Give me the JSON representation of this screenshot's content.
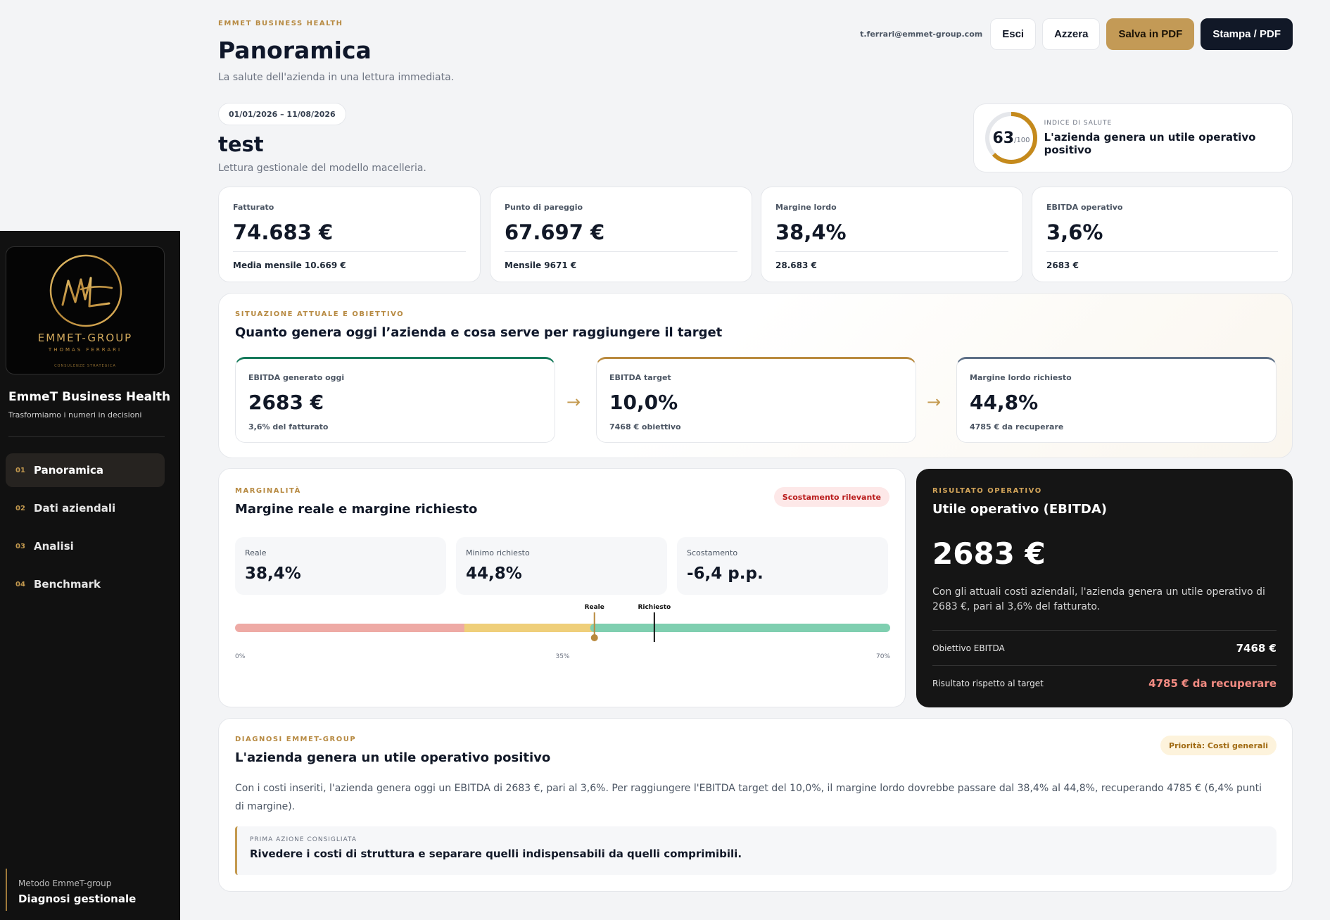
{
  "sidebar": {
    "logo": {
      "name": "EMMET-GROUP",
      "tagline": "THOMAS FERRARI",
      "micro": "CONSULENZE STRATEGICA"
    },
    "brand_title": "EmmeT Business Health",
    "brand_subtitle": "Trasformiamo i numeri in decisioni",
    "nav": [
      {
        "num": "01",
        "label": "Panoramica",
        "active": true
      },
      {
        "num": "02",
        "label": "Dati aziendali",
        "active": false
      },
      {
        "num": "03",
        "label": "Analisi",
        "active": false
      },
      {
        "num": "04",
        "label": "Benchmark",
        "active": false
      }
    ],
    "footer": {
      "line1": "Metodo EmmeT-group",
      "line2": "Diagnosi gestionale"
    }
  },
  "header": {
    "eyebrow": "EMMET BUSINESS HEALTH",
    "title": "Panoramica",
    "subtitle": "La salute dell'azienda in una lettura immediata.",
    "email": "t.ferrari@emmet-group.com",
    "buttons": {
      "logout": "Esci",
      "reset": "Azzera",
      "save_pdf": "Salva in PDF",
      "print": "Stampa / PDF"
    }
  },
  "company": {
    "period": "01/01/2026 – 11/08/2026",
    "name": "test",
    "subtitle": "Lettura gestionale del modello macelleria."
  },
  "health": {
    "score": 63,
    "score_suffix": "/100",
    "label": "INDICE DI SALUTE",
    "message": "L'azienda genera un utile operativo positivo",
    "color": "#c58a1c"
  },
  "kpis": [
    {
      "label": "Fatturato",
      "value": "74.683 €",
      "foot": "Media mensile 10.669 €"
    },
    {
      "label": "Punto di pareggio",
      "value": "67.697 €",
      "foot": "Mensile 9671 €"
    },
    {
      "label": "Margine lordo",
      "value": "38,4%",
      "foot": "28.683 €"
    },
    {
      "label": "EBITDA operativo",
      "value": "3,6%",
      "foot": "2683 €"
    }
  ],
  "situation": {
    "eyebrow": "SITUAZIONE ATTUALE E OBIETTIVO",
    "title": "Quanto genera oggi l’azienda e cosa serve per raggiungere il target",
    "cards": [
      {
        "label": "EBITDA generato oggi",
        "value": "2683 €",
        "foot": "3,6% del fatturato",
        "color": "#167a5b"
      },
      {
        "label": "EBITDA target",
        "value": "10,0%",
        "foot": "7468 € obiettivo",
        "color": "#b98a3e"
      },
      {
        "label": "Margine lordo richiesto",
        "value": "44,8%",
        "foot": "4785 € da recuperare",
        "color": "#5d6f86"
      }
    ]
  },
  "marginality": {
    "eyebrow": "MARGINALITÀ",
    "title": "Margine reale e margine richiesto",
    "badge": "Scostamento rilevante",
    "boxes": [
      {
        "label": "Reale",
        "value": "38,4%"
      },
      {
        "label": "Minimo richiesto",
        "value": "44,8%"
      },
      {
        "label": "Scostamento",
        "value": "-6,4 p.p."
      }
    ],
    "scale": {
      "min": 0,
      "max": 70,
      "real": 38.4,
      "required": 44.8,
      "real_label": "Reale",
      "required_label": "Richiesto",
      "tick_min": "0%",
      "tick_mid": "35%",
      "tick_max": "70%",
      "zone_red_end": 24.5,
      "zone_yellow_end": 38.4,
      "colors": {
        "red": "#eeaaa5",
        "yellow": "#efcf7a",
        "green": "#7fcfb0",
        "marker": "#b98a3e"
      }
    }
  },
  "ebitda": {
    "eyebrow": "RISULTATO OPERATIVO",
    "title": "Utile operativo (EBITDA)",
    "value": "2683 €",
    "description": "Con gli attuali costi aziendali, l'azienda genera un utile operativo di 2683 €, pari al 3,6% del fatturato.",
    "rows": [
      {
        "label": "Obiettivo EBITDA",
        "value": "7468 €"
      },
      {
        "label": "Risultato rispetto al target",
        "value": "4785 € da recuperare"
      }
    ]
  },
  "diagnosis": {
    "eyebrow": "DIAGNOSI EMMET-GROUP",
    "title": "L'azienda genera un utile operativo positivo",
    "badge": "Priorità: Costi generali",
    "text": "Con i costi inseriti, l'azienda genera oggi un EBITDA di 2683 €, pari al 3,6%. Per raggiungere l'EBITDA target del 10,0%, il margine lordo dovrebbe passare dal 38,4% al 44,8%, recuperando 4785 € (6,4% punti di margine).",
    "action_label": "PRIMA AZIONE CONSIGLIATA",
    "action": "Rivedere i costi di struttura e separare quelli indispensabili da quelli comprimibili."
  }
}
